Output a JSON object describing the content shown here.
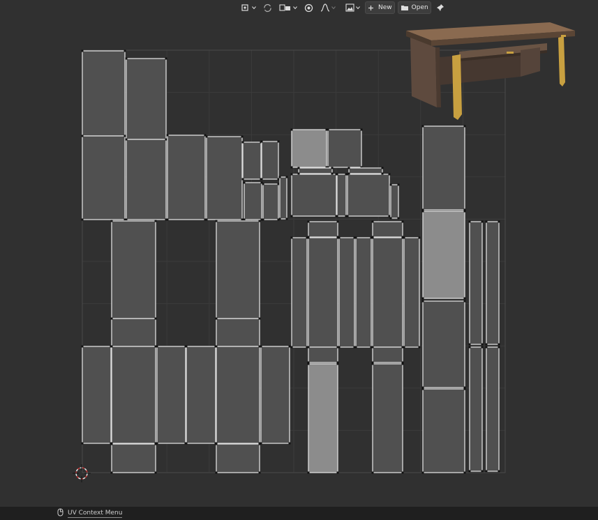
{
  "header": {
    "new_label": "New",
    "open_label": "Open",
    "icons": [
      "snap-target-icon",
      "uv-sync-selection-icon",
      "sticky-select-icon",
      "proportional-edit-icon",
      "falloff-curve-icon",
      "image-browse-icon",
      "plus-icon",
      "folder-icon",
      "pin-icon"
    ]
  },
  "colors": {
    "background": "#303030",
    "island_fill": "#505050",
    "island_selected_fill": "#8c8c8c",
    "edge": "#dddddd",
    "grid": "#3c3c3c",
    "status_bar": "#1f1f1f",
    "cursor": "#d03030"
  },
  "preview": {
    "description_icon": "desk-render-thumbnail"
  },
  "statusbar": {
    "context_menu_label": "UV Context Menu",
    "mouse_icon": "mouse-right-icon"
  }
}
